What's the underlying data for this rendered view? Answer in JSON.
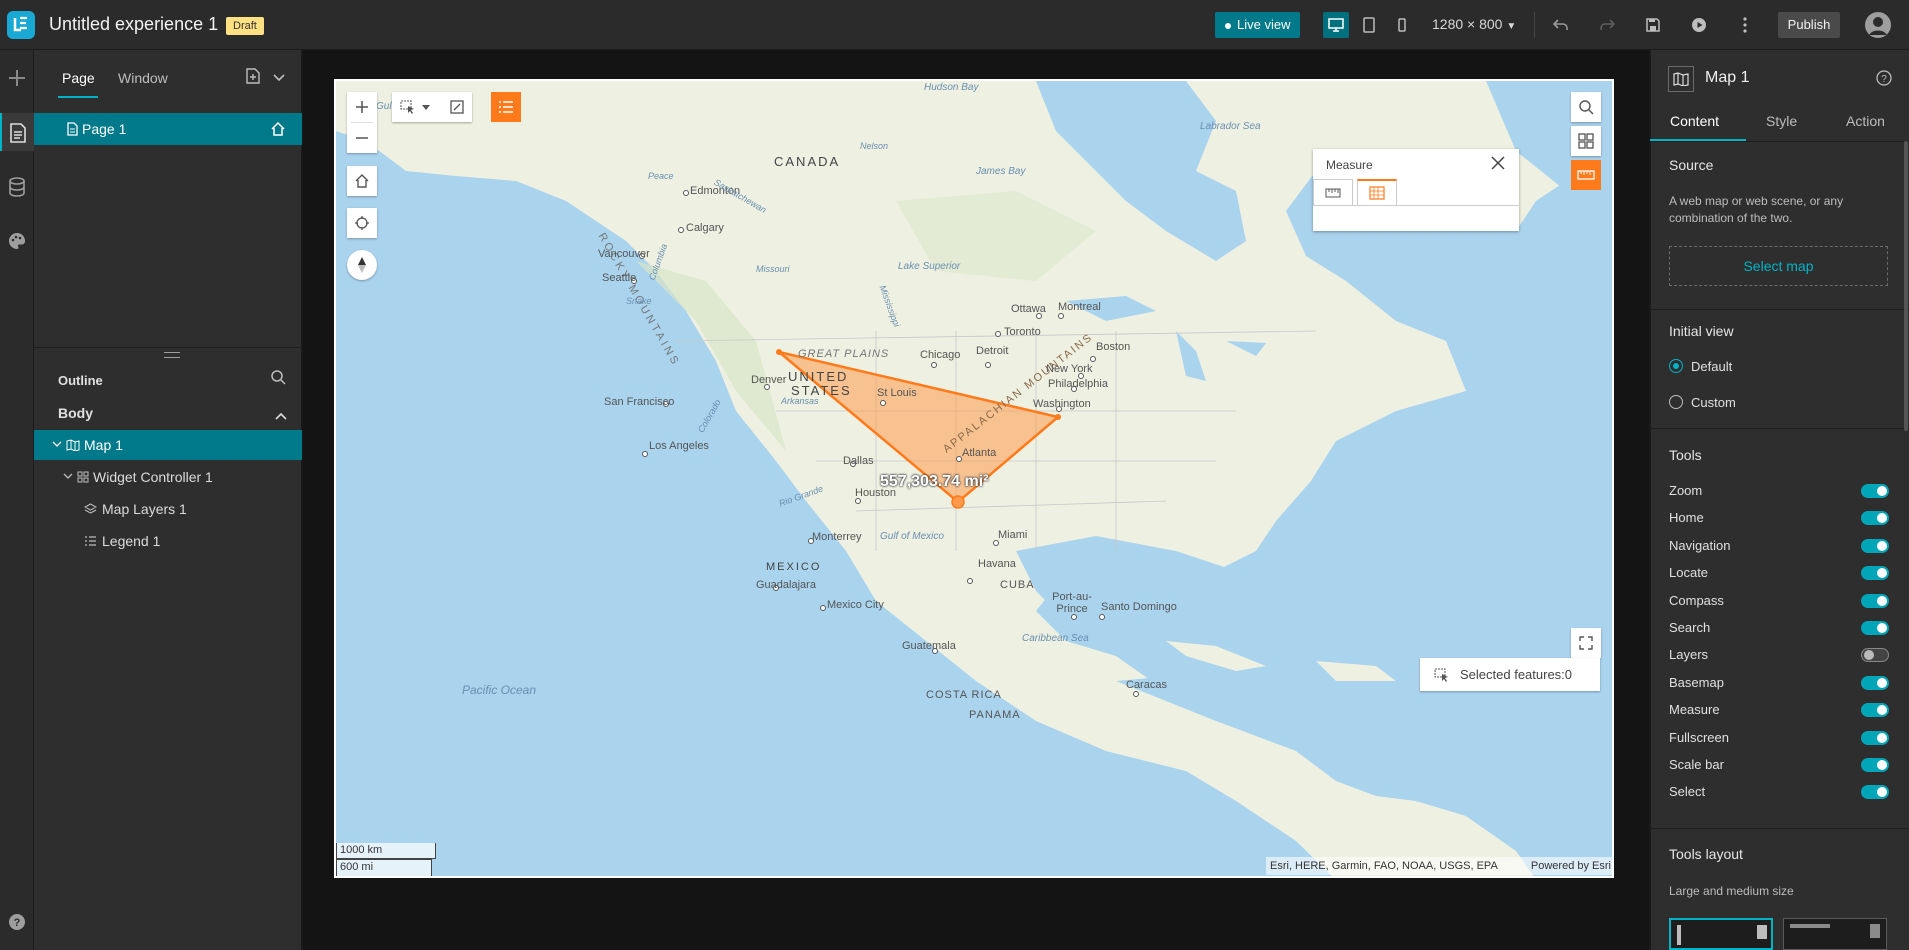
{
  "header": {
    "title": "Untitled experience 1",
    "draft_badge": "Draft",
    "live_view": "Live view",
    "resolution": "1280 × 800",
    "publish": "Publish"
  },
  "left_panel": {
    "tabs": [
      "Page",
      "Window"
    ],
    "page_item": "Page 1",
    "outline_title": "Outline",
    "body_title": "Body",
    "tree": [
      {
        "label": "Map 1",
        "level": 0
      },
      {
        "label": "Widget Controller 1",
        "level": 1
      },
      {
        "label": "Map Layers 1",
        "level": 2
      },
      {
        "label": "Legend 1",
        "level": 2
      }
    ]
  },
  "map": {
    "measure_title": "Measure",
    "area_label": "557,303.74 mi²",
    "selected_features": "Selected features:0",
    "scale_km": "1000 km",
    "scale_mi": "600 mi",
    "attribution": "Esri, HERE, Garmin, FAO, NOAA, USGS, EPA",
    "powered_by": "Powered by Esri",
    "labels": {
      "canada": "CANADA",
      "united": "UNITED",
      "states": "STATES",
      "mexico": "MEXICO",
      "cuba": "CUBA",
      "costa_rica": "COSTA RICA",
      "panama": "PANAMA",
      "rocky": "ROCKY MOUNTAINS",
      "appalachian": "APPALACHIAN MOUNTAINS",
      "great_plains": "GREAT PLAINS",
      "hudson_bay": "Hudson Bay",
      "labrador": "Labrador Sea",
      "james_bay": "James Bay",
      "lake_superior": "Lake Superior",
      "gulf_mexico": "Gulf of Mexico",
      "caribbean": "Caribbean Sea",
      "pacific": "Pacific Ocean",
      "gulf_alaska": "Gulf of Alaska",
      "edmonton": "Edmonton",
      "calgary": "Calgary",
      "vancouver": "Vancouver",
      "seattle": "Seattle",
      "san_francisco": "San Francisco",
      "los_angeles": "Los Angeles",
      "denver": "Denver",
      "dallas": "Dallas",
      "houston": "Houston",
      "st_louis": "St Louis",
      "chicago": "Chicago",
      "detroit": "Detroit",
      "toronto": "Toronto",
      "ottawa": "Ottawa",
      "montreal": "Montreal",
      "boston": "Boston",
      "new_york": "New York",
      "philadelphia": "Philadelphia",
      "washington": "Washington",
      "atlanta": "Atlanta",
      "miami": "Miami",
      "havana": "Havana",
      "monterrey": "Monterrey",
      "guadalajara": "Guadalajara",
      "mexico_city": "Mexico City",
      "guatemala": "Guatemala",
      "port_au_prince": "Port-au-Prince",
      "santo_domingo": "Santo Domingo",
      "caracas": "Caracas",
      "missouri": "Missouri",
      "arkansas": "Arkansas",
      "rio_grande": "Rio Grande",
      "colorado": "Colorado",
      "mississippi": "Mississippi",
      "saskatchewan": "Saskatchewan",
      "nelson": "Nelson",
      "peace": "Peace",
      "snake": "Snake",
      "columbia": "Columbia"
    }
  },
  "right_panel": {
    "title": "Map 1",
    "tabs": [
      "Content",
      "Style",
      "Action"
    ],
    "source_title": "Source",
    "source_desc": "A web map or web scene, or any combination of the two.",
    "select_map": "Select map",
    "initial_view_title": "Initial view",
    "initial_view_options": [
      "Default",
      "Custom"
    ],
    "tools_title": "Tools",
    "tools": [
      {
        "label": "Zoom",
        "on": true
      },
      {
        "label": "Home",
        "on": true
      },
      {
        "label": "Navigation",
        "on": true
      },
      {
        "label": "Locate",
        "on": true
      },
      {
        "label": "Compass",
        "on": true
      },
      {
        "label": "Search",
        "on": true
      },
      {
        "label": "Layers",
        "on": false
      },
      {
        "label": "Basemap",
        "on": true
      },
      {
        "label": "Measure",
        "on": true
      },
      {
        "label": "Fullscreen",
        "on": true
      },
      {
        "label": "Scale bar",
        "on": true
      },
      {
        "label": "Select",
        "on": true
      }
    ],
    "tools_layout_title": "Tools layout",
    "tools_layout_sub": "Large and medium size"
  },
  "colors": {
    "accent": "#007a8a",
    "accent_light": "#00b4c8",
    "measure_orange": "#ff7a1a"
  }
}
